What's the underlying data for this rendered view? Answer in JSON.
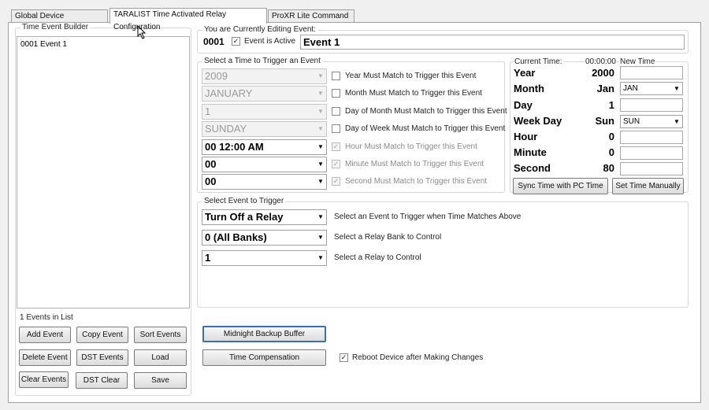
{
  "tabs": [
    {
      "label": "Global Device Configuration"
    },
    {
      "label": "TARALIST Time Activated Relay Configuration"
    },
    {
      "label": "ProXR Lite Command Set"
    }
  ],
  "builder": {
    "title": "Time Event Builder",
    "items": [
      "0001 Event 1"
    ],
    "count_text": "1 Events in List",
    "buttons": {
      "add": "Add Event",
      "copy": "Copy Event",
      "sort": "Sort Events",
      "delete": "Delete Event",
      "dst_events": "DST Events",
      "load": "Load",
      "clear": "Clear Events",
      "dst_clear": "DST Clear",
      "save": "Save"
    }
  },
  "editing": {
    "title": "You are Currently Editing Event:",
    "number": "0001",
    "active_label": "Event is Active",
    "active_checked": "✓",
    "name": "Event 1"
  },
  "trigger_time": {
    "title": "Select a Time to Trigger an Event",
    "rows": [
      {
        "value": "2009",
        "label": "Year Must Match to Trigger this Event",
        "checked": ""
      },
      {
        "value": "JANUARY",
        "label": "Month Must Match to Trigger this Event",
        "checked": ""
      },
      {
        "value": "1",
        "label": "Day of Month Must Match to Trigger this Event",
        "checked": ""
      },
      {
        "value": "SUNDAY",
        "label": "Day of Week Must Match to Trigger this Event",
        "checked": ""
      },
      {
        "value": "00   12:00 AM",
        "label": "Hour Must Match to Trigger this Event",
        "checked": "✓"
      },
      {
        "value": "00",
        "label": "Minute Must Match to Trigger this Event",
        "checked": "✓"
      },
      {
        "value": "00",
        "label": "Second Must Match to Trigger this Event",
        "checked": "✓"
      }
    ]
  },
  "clock": {
    "current_label": "Current Time:",
    "current_value": "00:00:00",
    "new_label": "New Time",
    "rows": [
      {
        "label": "Year",
        "value": "2000",
        "new": ""
      },
      {
        "label": "Month",
        "value": "Jan",
        "new": "JAN"
      },
      {
        "label": "Day",
        "value": "1",
        "new": ""
      },
      {
        "label": "Week Day",
        "value": "Sun",
        "new": "SUN"
      },
      {
        "label": "Hour",
        "value": "0",
        "new": ""
      },
      {
        "label": "Minute",
        "value": "0",
        "new": ""
      },
      {
        "label": "Second",
        "value": "80",
        "new": ""
      }
    ],
    "sync_button": "Sync Time with PC Time",
    "set_button": "Set Time Manually"
  },
  "event_trigger": {
    "title": "Select Event to Trigger",
    "rows": [
      {
        "value": "Turn Off a Relay",
        "label": "Select an Event to Trigger when Time Matches Above"
      },
      {
        "value": "0 (All Banks)",
        "label": "Select a Relay Bank to Control"
      },
      {
        "value": "1",
        "label": "Select a Relay to Control"
      }
    ]
  },
  "bottom": {
    "midnight_button": "Midnight Backup Buffer",
    "compensation_button": "Time Compensation",
    "reboot_label": "Reboot Device after Making Changes",
    "reboot_checked": "✓"
  }
}
